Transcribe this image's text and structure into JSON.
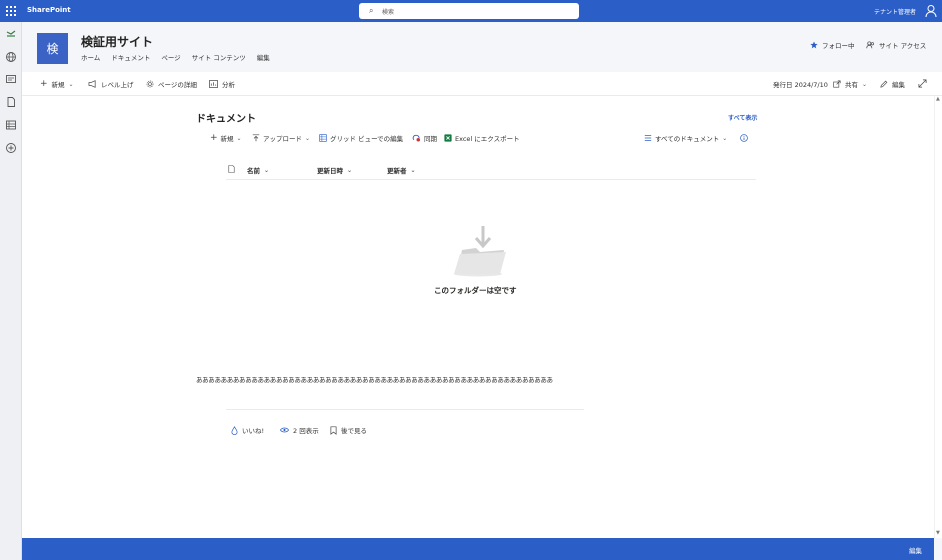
{
  "suitebar": {
    "app_name": "SharePoint",
    "search_placeholder": "検索",
    "user_name": "テナント管理者"
  },
  "site": {
    "logo_letter": "検",
    "title": "検証用サイト",
    "nav": [
      "ホーム",
      "ドキュメント",
      "ページ",
      "サイト コンテンツ",
      "編集"
    ],
    "follow_label": "フォロー中",
    "access_label": "サイト アクセス"
  },
  "commands": {
    "new_label": "新規",
    "promote_label": "レベル上げ",
    "page_details_label": "ページの詳細",
    "analytics_label": "分析",
    "published_label": "発行日 2024/7/10",
    "share_label": "共有",
    "edit_label": "編集"
  },
  "library": {
    "title": "ドキュメント",
    "see_all": "すべて表示",
    "new_label": "新規",
    "upload_label": "アップロード",
    "grid_edit_label": "グリッド ビューでの編集",
    "sync_label": "同期",
    "export_label": "Excel にエクスポート",
    "view_label": "すべてのドキュメント",
    "columns": [
      "名前",
      "更新日時",
      "更新者"
    ],
    "empty_message": "このフォルダーは空です"
  },
  "content": {
    "text": "ああああああああああああああああああああああああああああああああああああああああああああああああああああああああああ"
  },
  "social": {
    "like_label": "いいね!",
    "views_label": "2 回表示",
    "save_label": "後で見る"
  },
  "footer": {
    "edit_label": "編集"
  },
  "colors": {
    "suite_bar": "#2b5fc7",
    "accent_link": "#2b5fc7",
    "site_logo": "#3b62c5",
    "excel_green": "#107c41"
  }
}
